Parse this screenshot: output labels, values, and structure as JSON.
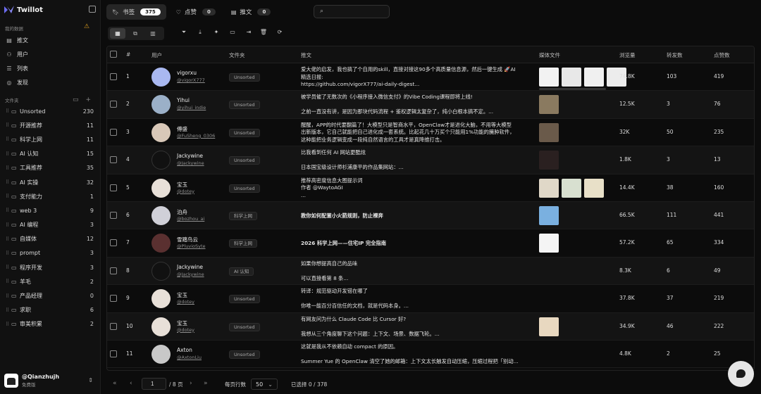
{
  "brand": {
    "name": "Twillot"
  },
  "sidebar": {
    "section_my_data": "我的数据",
    "nav": [
      {
        "label": "推文",
        "icon": "tweet-icon"
      },
      {
        "label": "用户",
        "icon": "users-icon"
      },
      {
        "label": "列表",
        "icon": "list-icon"
      },
      {
        "label": "发现",
        "icon": "discover-icon"
      }
    ],
    "section_folders": "文件夹",
    "folders": [
      {
        "name": "Unsorted",
        "count": "230"
      },
      {
        "name": "开源推荐",
        "count": "11"
      },
      {
        "name": "科学上网",
        "count": "11"
      },
      {
        "name": "AI 认知",
        "count": "15"
      },
      {
        "name": "工具推荐",
        "count": "35"
      },
      {
        "name": "AI 实操",
        "count": "32"
      },
      {
        "name": "支付能力",
        "count": "1"
      },
      {
        "name": "web 3",
        "count": "9"
      },
      {
        "name": "AI 编程",
        "count": "3"
      },
      {
        "name": "自媒体",
        "count": "12"
      },
      {
        "name": "prompt",
        "count": "3"
      },
      {
        "name": "程序开发",
        "count": "3"
      },
      {
        "name": "羊毛",
        "count": "2"
      },
      {
        "name": "产品经理",
        "count": "0"
      },
      {
        "name": "求职",
        "count": "6"
      },
      {
        "name": "审美积累",
        "count": "2"
      }
    ],
    "user": {
      "name": "@Qianzhujh",
      "plan": "免费版"
    }
  },
  "tabs": [
    {
      "label": "书签",
      "count": "375",
      "icon": "bookmark-icon"
    },
    {
      "label": "点赞",
      "count": "0",
      "icon": "heart-icon"
    },
    {
      "label": "推文",
      "count": "0",
      "icon": "document-icon"
    }
  ],
  "search": {
    "placeholder": "",
    "value": ""
  },
  "table": {
    "headers": {
      "num": "#",
      "user": "用户",
      "folder": "文件夹",
      "tweet": "推文",
      "media": "媒体文件",
      "views": "浏览量",
      "retweets": "转发数",
      "likes": "点赞数"
    },
    "rows": [
      {
        "n": "1",
        "name": "vigorxu",
        "handle": "@vigorX777",
        "folder": "Unsorted",
        "line1": "爱大佬的启发，我也搞了个自用的skill，直接对接这90多个高质量信息源，然后一键生成 🚀AI",
        "line2": "精选日报:",
        "line3": "https://github.com/vigorX777/ai-daily-digest...",
        "views": "74.8K",
        "retweets": "103",
        "likes": "419"
      },
      {
        "n": "2",
        "name": "Yihui",
        "handle": "@yihui_indie",
        "folder": "Unsorted",
        "line1": "被学员催了无数次的《小程序接入微信支付》的Vibe Coding课程即将上线!",
        "line2": "",
        "line3": "之前一直没有讲，是因为那块代码流程 + 鉴权逻辑太复杂了，纯小白根本搞不定。...",
        "views": "12.5K",
        "retweets": "3",
        "likes": "76"
      },
      {
        "n": "3",
        "name": "傅盛",
        "handle": "@FuSheng_0306",
        "folder": "Unsorted",
        "line1": "醒醒，APP的时代要翻篇了！大模型只是智商水平，OpenClaw才是进化大脑，不用等大模型",
        "line2": "出新版本，它自己就能把自己进化成一套系统。比起花几十万买个只能用1%功能的臃肿软件，",
        "line3": "这种能把业务逻辑变成一段纯自然语言的工具才是真降维打击。",
        "views": "32K",
        "retweets": "50",
        "likes": "235"
      },
      {
        "n": "4",
        "name": "Jackywine",
        "handle": "@Jackywine",
        "folder": "Unsorted",
        "line1": "比我看到任何 AI 网站更酷炫",
        "line2": "",
        "line3": "日本国宝级设计师杉浦康平的作品集网站：...",
        "views": "1.8K",
        "retweets": "3",
        "likes": "13"
      },
      {
        "n": "5",
        "name": "宝玉",
        "handle": "@dotey",
        "folder": "Unsorted",
        "line1": "推荐高密度信息大图提示词",
        "line2": "作者 @WaytoAGI",
        "line3": "...",
        "views": "14.4K",
        "retweets": "38",
        "likes": "160"
      },
      {
        "n": "6",
        "name": "泊舟",
        "handle": "@bozhou_ai",
        "folder": "科学上网",
        "line1": "",
        "line2": "教你如何配置小火箭规则，防止裸奔",
        "line3": "",
        "views": "66.5K",
        "retweets": "111",
        "likes": "441"
      },
      {
        "n": "7",
        "name": "雪踏鸟云",
        "handle": "@PluvioSyte",
        "folder": "科学上网",
        "line1": "",
        "line2": " 2026 科学上网——住宅IP 完全指南",
        "line3": "",
        "views": "57.2K",
        "retweets": "65",
        "likes": "334"
      },
      {
        "n": "8",
        "name": "Jackywine",
        "handle": "@Jackywine",
        "folder": "AI 认知",
        "line1": "如果你想提高自己的品味",
        "line2": "",
        "line3": "可以直接看第 8 条...",
        "views": "8.3K",
        "retweets": "6",
        "likes": "49"
      },
      {
        "n": "9",
        "name": "宝玉",
        "handle": "@dotey",
        "folder": "Unsorted",
        "line1": "转译：规范驱动开发错在哪了",
        "line2": "",
        "line3": "你唯一能百分百信任的文档，就是代码本身。...",
        "views": "37.8K",
        "retweets": "37",
        "likes": "219"
      },
      {
        "n": "10",
        "name": "宝玉",
        "handle": "@dotey",
        "folder": "Unsorted",
        "line1": "有网友问为什么 Claude Code 比 Cursor 好?",
        "line2": "",
        "line3": "我想从三个角度聊下这个问题：上下文、场景、数据飞轮。...",
        "views": "34.9K",
        "retweets": "46",
        "likes": "222"
      },
      {
        "n": "11",
        "name": "Axton",
        "handle": "@AxtonLiu",
        "folder": "Unsorted",
        "line1": "这就是我从不依赖自动 compact 的原因。",
        "line2": "",
        "line3": "Summer Yue 的 OpenClaw 清空了她的邮箱：上下文太长触发自动压缩，压缩过程把「别动...",
        "views": "4.8K",
        "retweets": "2",
        "likes": "25"
      }
    ]
  },
  "pager": {
    "page": "1",
    "total_pages": "/ 8 页",
    "rows_label": "每页行数",
    "page_size": "50",
    "selected": "已选择 0 / 378"
  }
}
